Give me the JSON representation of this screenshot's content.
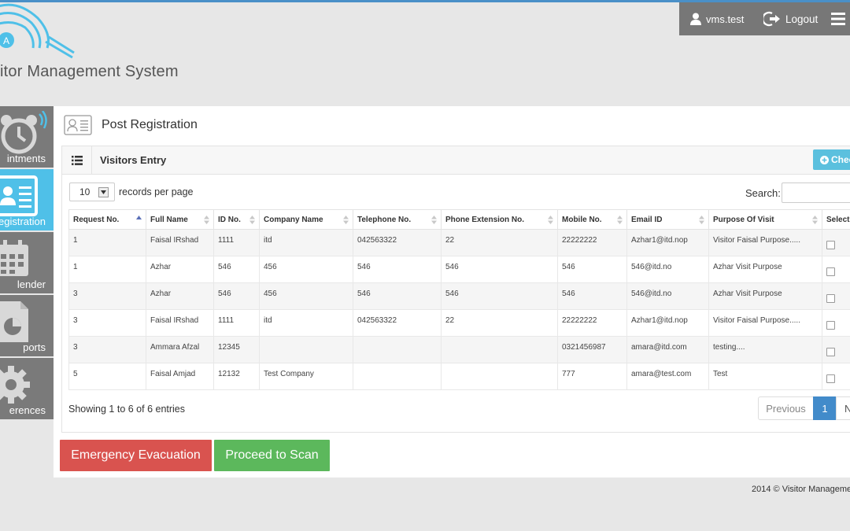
{
  "app": {
    "logo_title": "itor Management System",
    "logo_badge": "A"
  },
  "userbar": {
    "username": "vms.test",
    "logout_label": "Logout"
  },
  "sidebar": {
    "items": [
      {
        "label": "intments",
        "icon": "alarm-clock-icon",
        "active": false
      },
      {
        "label": "egistration",
        "icon": "id-card-icon",
        "active": true
      },
      {
        "label": "lender",
        "icon": "calendar-icon",
        "active": false
      },
      {
        "label": "ports",
        "icon": "report-chart-icon",
        "active": false
      },
      {
        "label": "erences",
        "icon": "gear-icon",
        "active": false
      }
    ]
  },
  "page": {
    "title": "Post Registration"
  },
  "box": {
    "title": "Visitors Entry",
    "check_button": "Check"
  },
  "table_controls": {
    "page_size": "10",
    "records_label": "records per page",
    "search_label": "Search:",
    "search_value": ""
  },
  "table": {
    "columns": [
      "Request No.",
      "Full Name",
      "ID No.",
      "Company Name",
      "Telephone No.",
      "Phone Extension No.",
      "Mobile No.",
      "Email ID",
      "Purpose Of Visit",
      "Select"
    ],
    "rows": [
      [
        "1",
        "Faisal IRshad",
        "1111",
        "itd",
        "042563322",
        "22",
        "22222222",
        "Azhar1@itd.nop",
        "Visitor Faisal Purpose....."
      ],
      [
        "1",
        "Azhar",
        "546",
        "456",
        "546",
        "546",
        "546",
        "546@itd.no",
        "Azhar Visit Purpose"
      ],
      [
        "3",
        "Azhar",
        "546",
        "456",
        "546",
        "546",
        "546",
        "546@itd.no",
        "Azhar Visit Purpose"
      ],
      [
        "3",
        "Faisal IRshad",
        "1111",
        "itd",
        "042563322",
        "22",
        "22222222",
        "Azhar1@itd.nop",
        "Visitor Faisal Purpose....."
      ],
      [
        "3",
        "Ammara Afzal",
        "12345",
        "",
        "",
        "",
        "0321456987",
        "amara@itd.com",
        "testing...."
      ],
      [
        "5",
        "Faisal Amjad",
        "12132",
        "Test Company",
        "",
        "",
        "777",
        "amara@test.com",
        "Test"
      ]
    ]
  },
  "pagination": {
    "info": "Showing 1 to 6 of 6 entries",
    "previous": "Previous",
    "current": "1",
    "next": "N"
  },
  "actions": {
    "evacuation": "Emergency Evacuation",
    "scan": "Proceed to Scan"
  },
  "footer": {
    "text": "2014 © Visitor Manageme"
  },
  "colors": {
    "accent_blue": "#4fc0e8",
    "sidebar_gray": "#7a7a7a",
    "danger": "#d9534f",
    "success": "#5cb85c",
    "primary": "#428bca",
    "info": "#5bc0de"
  }
}
